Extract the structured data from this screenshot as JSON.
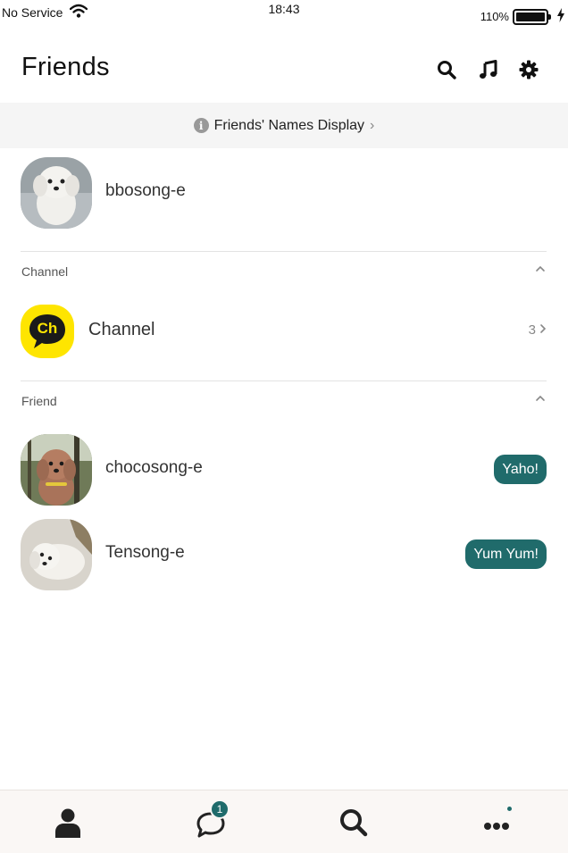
{
  "status_bar": {
    "carrier": "No Service",
    "time": "18:43",
    "battery_percent": "110%"
  },
  "header": {
    "title": "Friends",
    "icons": [
      "search-icon",
      "music-icon",
      "gear-icon"
    ]
  },
  "banner": {
    "label": "Friends' Names Display",
    "icon": "info-icon"
  },
  "profile": {
    "name": "bbosong-e"
  },
  "channel_section": {
    "label": "Channel",
    "item": {
      "logo_text": "Ch",
      "name": "Channel",
      "count": "3"
    }
  },
  "friend_section": {
    "label": "Friend",
    "items": [
      {
        "name": "chocosong-e",
        "status": "Yaho!"
      },
      {
        "name": "Tensong-e",
        "status": "Yum Yum!"
      }
    ]
  },
  "tabbar": {
    "tabs": [
      "friends-tab",
      "chats-tab",
      "search-tab",
      "more-tab"
    ],
    "chat_badge": "1"
  },
  "colors": {
    "accent": "#206b6b",
    "channel_yellow": "#fee500",
    "banner_bg": "#f5f5f5",
    "tabbar_bg": "#faf7f5"
  }
}
